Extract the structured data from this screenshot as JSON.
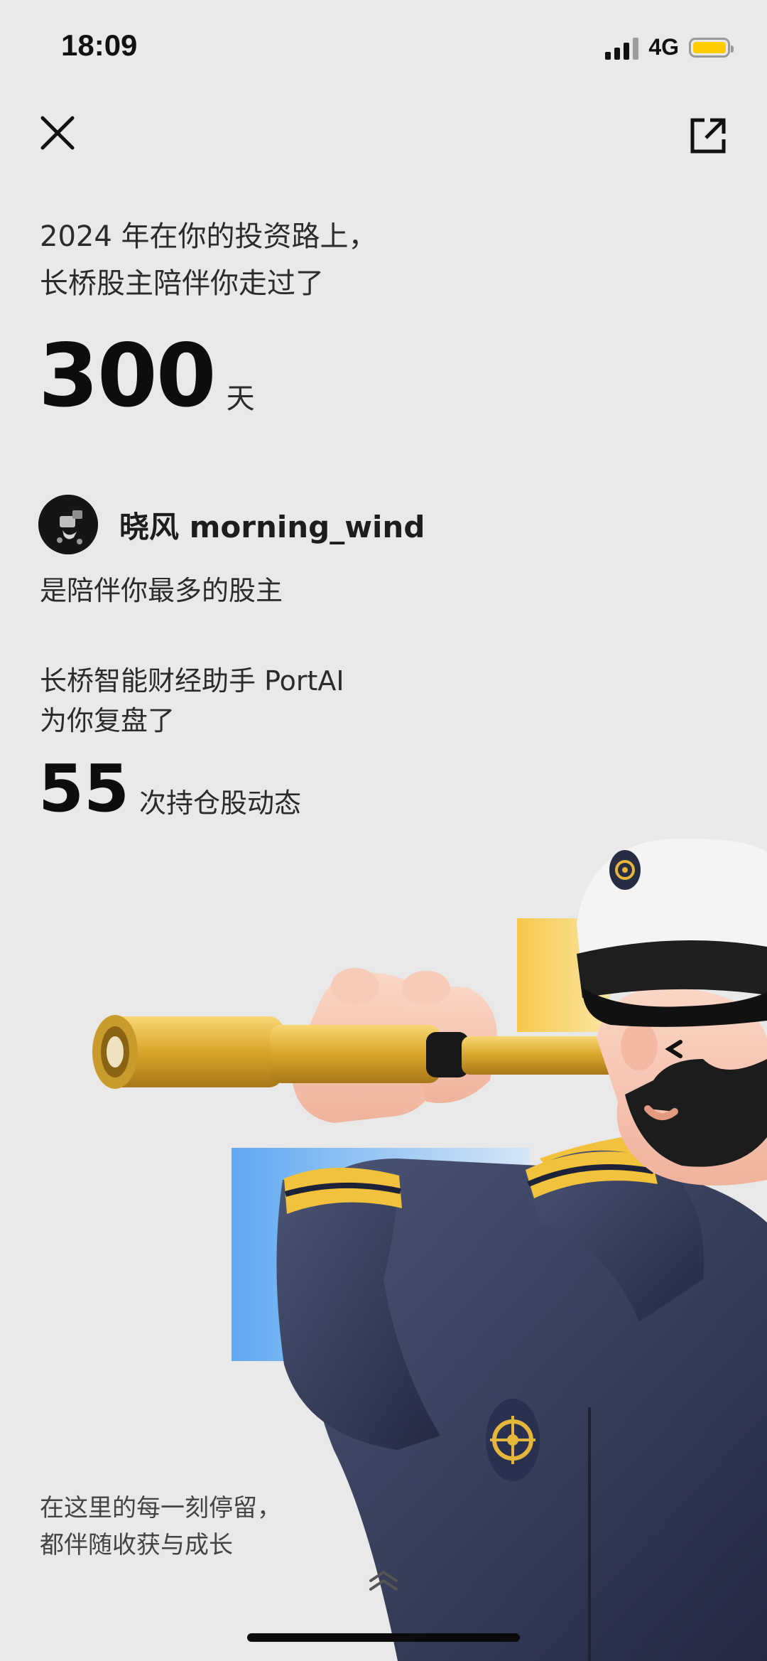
{
  "status_bar": {
    "time": "18:09",
    "network": "4G",
    "battery_color": "#ffcc00"
  },
  "header": {
    "close_icon": "close-icon",
    "share_icon": "share-icon"
  },
  "intro": {
    "line1": "2024 年在你的投资路上，",
    "line2": "长桥股主陪伴你走过了"
  },
  "days": {
    "value": "300",
    "unit": "天"
  },
  "buddy": {
    "name": "晓风 morning_wind",
    "description": "是陪伴你最多的股主"
  },
  "ai_review": {
    "line1": "长桥智能财经助手 PortAI",
    "line2": "为你复盘了",
    "count": "55",
    "unit": "次持仓股动态"
  },
  "footer": {
    "line1": "在这里的每一刻停留，",
    "line2": "都伴随收获与成长",
    "scroll_icon": "double-chevron-up-icon"
  },
  "colors": {
    "background": "#e9e9e9",
    "accent_yellow": "#f7c84a",
    "accent_blue": "#5fa9f2",
    "accent_red": "#f6676e",
    "navy": "#2f3752"
  }
}
